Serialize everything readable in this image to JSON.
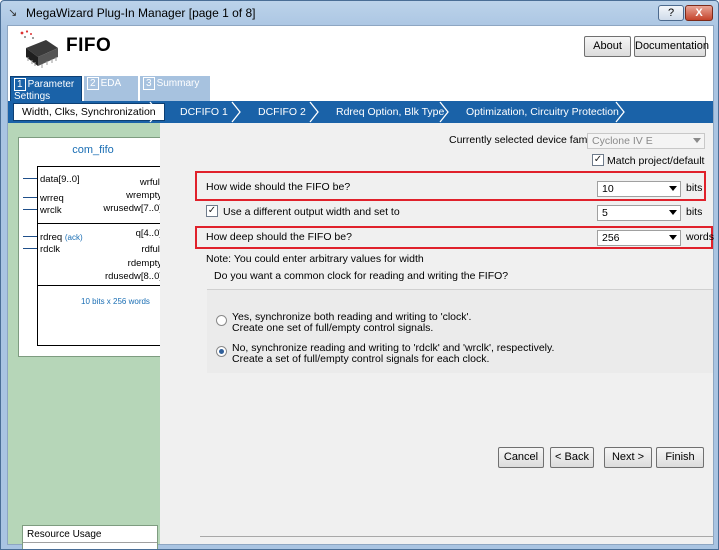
{
  "window": {
    "title": "MegaWizard Plug-In Manager [page 1 of 8]",
    "help_label": "?",
    "close_label": "X"
  },
  "header": {
    "app_name": "FIFO",
    "about_label": "About",
    "documentation_label": "Documentation"
  },
  "tabs": [
    {
      "num": "1",
      "label": "Parameter Settings"
    },
    {
      "num": "2",
      "label": "EDA"
    },
    {
      "num": "3",
      "label": "Summary"
    }
  ],
  "subtabs": [
    "Width, Clks, Synchronization",
    "DCFIFO 1",
    "DCFIFO 2",
    "Rdreq Option, Blk Type",
    "Optimization, Circuitry Protection"
  ],
  "symbol": {
    "title": "com_fifo",
    "left_ports_write": [
      "data[9..0]",
      "wrreq",
      "wrclk"
    ],
    "right_ports_write": [
      "wrfull",
      "wrempty",
      "wrusedw[7..0]"
    ],
    "left_ports_read": [
      "rdreq",
      "rdclk"
    ],
    "ack_label": "(ack)",
    "right_ports_read": [
      "q[4..0]",
      "rdfull",
      "rdempty",
      "rdusedw[8..0]"
    ],
    "size_label": "10 bits x 256 words"
  },
  "resource": {
    "title": "Resource Usage",
    "value": "..."
  },
  "settings": {
    "device_family_label": "Currently selected device family:",
    "device_family_value": "Cyclone IV E",
    "match_label": "Match project/default",
    "match_checked": true,
    "width_question": "How wide should the FIFO be?",
    "width_value": "10",
    "width_unit": "bits",
    "diff_output_label": "Use a different output width and set to",
    "diff_output_checked": true,
    "output_width_value": "5",
    "output_width_unit": "bits",
    "depth_question": "How deep should the FIFO be?",
    "depth_value": "256",
    "depth_unit": "words",
    "note": "Note: You could enter arbitrary values for width",
    "clock_question": "Do you want a common clock for reading and writing the FIFO?",
    "option_sync_line1": "Yes, synchronize both reading and writing to 'clock'.",
    "option_sync_line2": "Create one set of full/empty control signals.",
    "option_sync_selected": false,
    "option_nosync_line1": "No, synchronize reading and writing to 'rdclk' and 'wrclk', respectively.",
    "option_nosync_line2": "Create a set of full/empty control signals for each clock.",
    "option_nosync_selected": true
  },
  "footer": {
    "cancel_label": "Cancel",
    "back_label": "< Back",
    "next_label": "Next >",
    "finish_label": "Finish"
  }
}
